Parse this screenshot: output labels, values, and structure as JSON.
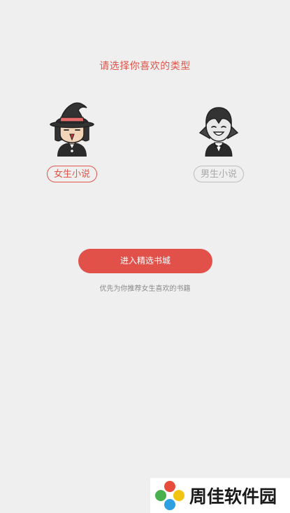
{
  "prompt": {
    "title": "请选择你喜欢的类型"
  },
  "choices": [
    {
      "label": "女生小说",
      "icon": "witch-avatar-icon",
      "selected": true
    },
    {
      "label": "男生小说",
      "icon": "vampire-avatar-icon",
      "selected": false
    }
  ],
  "actions": {
    "enter_label": "进入精选书城",
    "hint": "优先为你推荐女生喜欢的书籍"
  },
  "watermark": {
    "text": "周佳软件园",
    "icon": "flower-logo-icon"
  },
  "colors": {
    "accent": "#e15549",
    "button": "#e1514a",
    "background": "#efefef",
    "unselected": "#bdbdbd"
  }
}
